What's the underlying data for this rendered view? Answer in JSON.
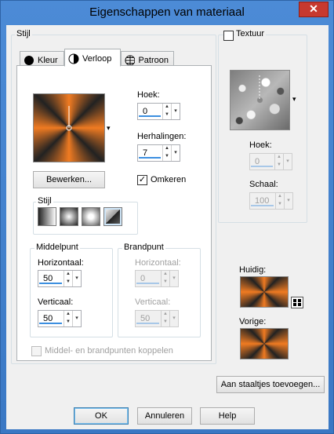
{
  "window": {
    "title": "Eigenschappen van materiaal",
    "close_glyph": "✕"
  },
  "left": {
    "group_label": "Stijl",
    "tabs": [
      {
        "label": "Kleur",
        "icon": "solid-circle-icon"
      },
      {
        "label": "Verloop",
        "icon": "half-circle-icon",
        "active": true
      },
      {
        "label": "Patroon",
        "icon": "globe-pattern-icon"
      }
    ],
    "gradient_dropdown_glyph": "▾",
    "angle": {
      "label": "Hoek:",
      "value": "0"
    },
    "repeats": {
      "label": "Herhalingen:",
      "value": "7"
    },
    "edit_button": "Bewerken...",
    "invert": {
      "label": "Omkeren",
      "checked": true
    },
    "style_group": {
      "label": "Stijl",
      "options": [
        "linear",
        "rectangular",
        "sunburst",
        "radial"
      ],
      "selected": 3
    },
    "center_point": {
      "label": "Middelpunt",
      "horizontal_label": "Horizontaal:",
      "horizontal_value": "50",
      "vertical_label": "Verticaal:",
      "vertical_value": "50"
    },
    "focal_point": {
      "label": "Brandpunt",
      "horizontal_label": "Horizontaal:",
      "horizontal_value": "0",
      "vertical_label": "Verticaal:",
      "vertical_value": "50",
      "enabled": false
    },
    "link_points": {
      "label": "Middel- en brandpunten koppelen",
      "checked": false,
      "enabled": false
    }
  },
  "right": {
    "texture": {
      "label": "Textuur",
      "checked": false
    },
    "texture_dropdown_glyph": "▾",
    "angle": {
      "label": "Hoek:",
      "value": "0",
      "enabled": false
    },
    "scale": {
      "label": "Schaal:",
      "value": "100",
      "enabled": false
    },
    "current_label": "Huidig:",
    "previous_label": "Vorige:",
    "add_swatch_button": "Aan staaltjes toevoegen..."
  },
  "footer": {
    "ok": "OK",
    "cancel": "Annuleren",
    "help": "Help"
  }
}
